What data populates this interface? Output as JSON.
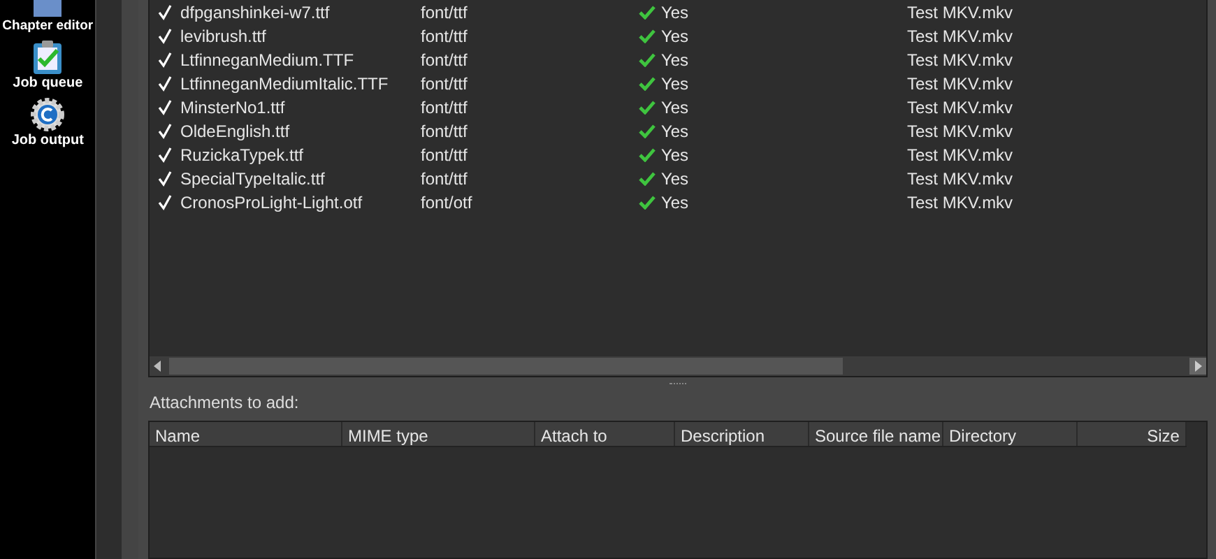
{
  "sidebar": {
    "items": [
      {
        "label": "Chapter editor",
        "kind": "chapter"
      },
      {
        "label": "Job queue",
        "kind": "queue"
      },
      {
        "label": "Job output",
        "kind": "output"
      }
    ]
  },
  "existing_attachments": {
    "rows": [
      {
        "name": "dfpganshinkei-w7.ttf",
        "checked": true,
        "mime": "font/ttf",
        "attach": "Yes",
        "source": "Test MKV.mkv"
      },
      {
        "name": "levibrush.ttf",
        "checked": true,
        "mime": "font/ttf",
        "attach": "Yes",
        "source": "Test MKV.mkv"
      },
      {
        "name": "LtfinneganMedium.TTF",
        "checked": true,
        "mime": "font/ttf",
        "attach": "Yes",
        "source": "Test MKV.mkv"
      },
      {
        "name": "LtfinneganMediumItalic.TTF",
        "checked": true,
        "mime": "font/ttf",
        "attach": "Yes",
        "source": "Test MKV.mkv"
      },
      {
        "name": "MinsterNo1.ttf",
        "checked": true,
        "mime": "font/ttf",
        "attach": "Yes",
        "source": "Test MKV.mkv"
      },
      {
        "name": "OldeEnglish.ttf",
        "checked": true,
        "mime": "font/ttf",
        "attach": "Yes",
        "source": "Test MKV.mkv"
      },
      {
        "name": "RuzickaTypek.ttf",
        "checked": true,
        "mime": "font/ttf",
        "attach": "Yes",
        "source": "Test MKV.mkv"
      },
      {
        "name": "SpecialTypeItalic.ttf",
        "checked": true,
        "mime": "font/ttf",
        "attach": "Yes",
        "source": "Test MKV.mkv"
      },
      {
        "name": "CronosProLight-Light.otf",
        "checked": true,
        "mime": "font/otf",
        "attach": "Yes",
        "source": "Test MKV.mkv"
      }
    ]
  },
  "attachments_to_add": {
    "label": "Attachments to add:",
    "columns": [
      "Name",
      "MIME type",
      "Attach to",
      "Description",
      "Source file name",
      "Directory",
      "Size"
    ]
  }
}
